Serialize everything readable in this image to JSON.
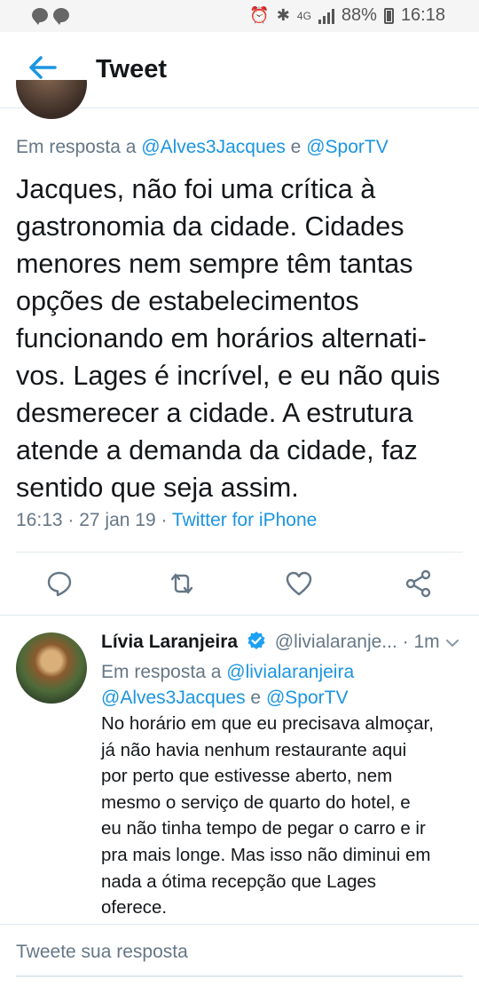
{
  "status_bar": {
    "network": "4G",
    "battery": "88%",
    "time": "16:18"
  },
  "app_bar": {
    "title": "Tweet"
  },
  "main_tweet": {
    "reply_prefix": "Em resposta a",
    "reply_user1": "@Alves3Jacques",
    "reply_joiner": "e",
    "reply_user2": "@SporTV",
    "text": "Jacques, não foi uma crítica à\ngastronomia da cidade. Cidades\nmenores nem sempre têm tantas\nopções de estabelecimentos\nfuncionando em horários alternati-\nvos. Lages é incrível, e eu não quis\ndesmerecer a cidade. A estrutura\natende a demanda da cidade, faz\nsentido que seja assim.",
    "timestamp": "16:13 · 27 jan 19 · ",
    "source": "Twitter for iPhone"
  },
  "actions": [
    "reply-icon",
    "retweet-icon",
    "like-icon",
    "share-icon"
  ],
  "reply": {
    "name": "Lívia Laranjeira",
    "handle": "@livialaranje...",
    "time_sep": "·",
    "time": "1m",
    "reply_prefix": "Em resposta a",
    "reply_users_line1": "@livialaranjeira",
    "reply_users_line2a": "@Alves3Jacques",
    "reply_joiner": "e",
    "reply_users_line2b": "@SporTV",
    "text": "No horário em que eu precisava almoçar,\njá não havia nenhum restaurante aqui\npor perto que estivesse aberto, nem\nmesmo o serviço de quarto do hotel, e\neu não tinha tempo de pegar o carro e ir\npra mais longe. Mas isso não diminui em\nnada a ótima recepção que Lages\noferece."
  },
  "composer": {
    "placeholder": "Tweete sua resposta"
  },
  "colors": {
    "accent": "#1b95e0",
    "muted": "#657786",
    "text": "#14171a"
  }
}
